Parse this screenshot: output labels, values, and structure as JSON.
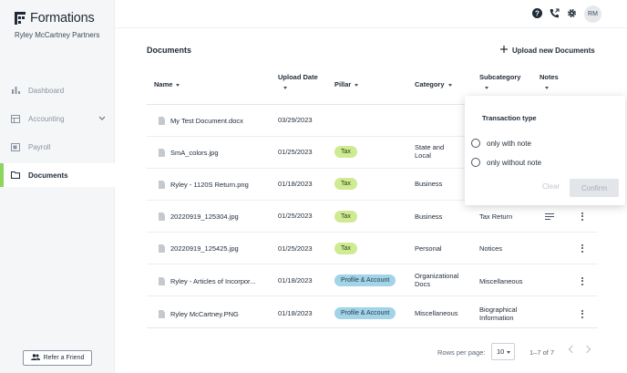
{
  "sidebar": {
    "brand": "Formations",
    "company": "Ryley McCartney Partners",
    "items": [
      {
        "label": "Dashboard",
        "icon": "bar-chart-icon"
      },
      {
        "label": "Accounting",
        "icon": "ledger-icon"
      },
      {
        "label": "Payroll",
        "icon": "payroll-icon"
      },
      {
        "label": "Documents",
        "icon": "folder-icon",
        "active": true
      }
    ],
    "refer_label": "Refer a Friend"
  },
  "topbar": {
    "avatar_initials": "RM"
  },
  "main": {
    "title": "Documents",
    "upload_label": "Upload new Documents",
    "columns": {
      "name": "Name",
      "upload_date": "Upload Date",
      "pillar": "Pillar",
      "category": "Category",
      "subcategory": "Subcategory",
      "notes": "Notes"
    },
    "rows": [
      {
        "name": "My Test Document.docx",
        "date": "03/29/2023",
        "pillar": "",
        "category": "",
        "subcategory": ""
      },
      {
        "name": "SmA_colors.jpg",
        "date": "01/25/2023",
        "pillar": "Tax",
        "category": "State and Local",
        "subcategory": ""
      },
      {
        "name": "Ryley - 1120S Return.png",
        "date": "01/18/2023",
        "pillar": "Tax",
        "category": "Business",
        "subcategory": ""
      },
      {
        "name": "20220919_125304.jpg",
        "date": "01/25/2023",
        "pillar": "Tax",
        "category": "Business",
        "subcategory": "Tax Return"
      },
      {
        "name": "20220919_125425.jpg",
        "date": "01/25/2023",
        "pillar": "Tax",
        "category": "Personal",
        "subcategory": "Notices"
      },
      {
        "name": "Ryley - Articles of Incorpor...",
        "date": "01/18/2023",
        "pillar": "Profile & Account",
        "category": "Organizational Docs",
        "subcategory": "Miscellaneous"
      },
      {
        "name": "Ryley McCartney.PNG",
        "date": "01/18/2023",
        "pillar": "Profile & Account",
        "category": "Miscellaneous",
        "subcategory": "Biographical Information"
      }
    ],
    "pagination": {
      "rows_per_page_label": "Rows per page:",
      "rows_per_page": "10",
      "range": "1–7 of 7"
    }
  },
  "filter_popover": {
    "title": "Transaction type",
    "options": [
      "only with note",
      "only without note"
    ],
    "clear_label": "Clear",
    "confirm_label": "Confirm"
  },
  "colors": {
    "accent_green": "#8bd65e",
    "tax_badge": "#cfeb91",
    "profile_badge": "#a3d3e6"
  }
}
